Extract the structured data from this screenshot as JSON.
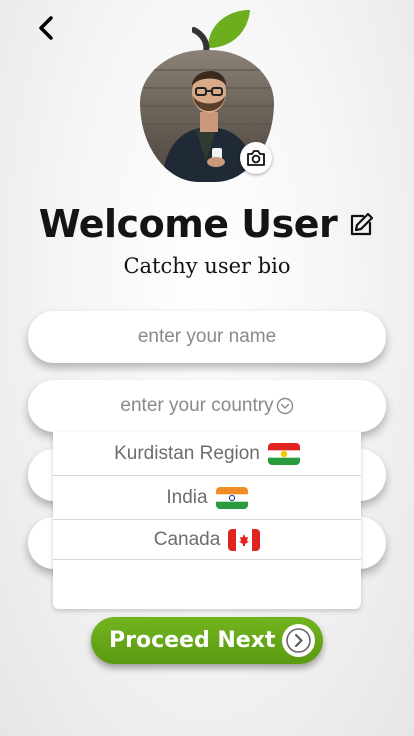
{
  "header": {
    "back_icon": "chevron-left-icon"
  },
  "profile": {
    "avatar_icon": "apple-leaf-icon",
    "camera_icon": "camera-icon",
    "title": "Welcome User",
    "edit_icon": "edit-icon",
    "bio": "Catchy user bio"
  },
  "form": {
    "name_placeholder": "enter your name",
    "country_placeholder": "enter your country",
    "country_chevron_icon": "chevron-down-circle-icon"
  },
  "country_dropdown": {
    "options": [
      {
        "label": "Kurdistan Region",
        "flag": "kurdistan-flag-icon"
      },
      {
        "label": "India",
        "flag": "india-flag-icon"
      },
      {
        "label": "Canada",
        "flag": "canada-flag-icon"
      }
    ]
  },
  "actions": {
    "proceed_label": "Proceed Next",
    "proceed_icon": "chevron-right-circle-icon"
  },
  "colors": {
    "accent_green": "#5a9a12",
    "leaf_green": "#6cae1e",
    "title_text": "#141414",
    "placeholder_text": "#8a8a8a"
  }
}
